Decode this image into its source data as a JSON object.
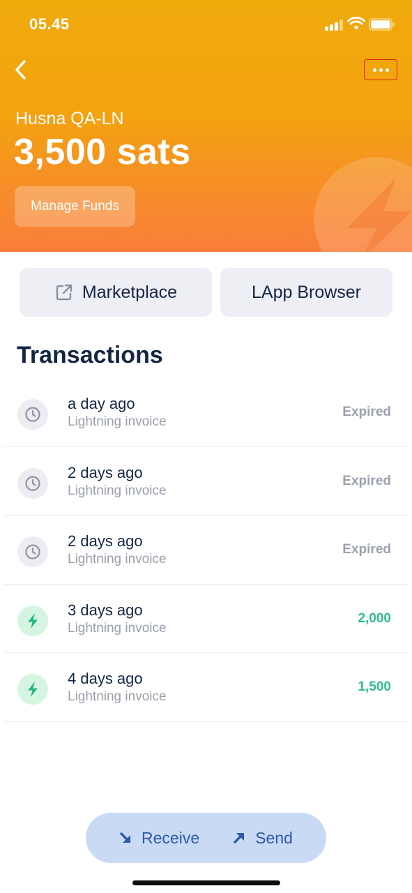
{
  "status_bar": {
    "time": "05.45"
  },
  "header": {
    "wallet_name": "Husna QA-LN",
    "balance": "3,500 sats",
    "manage_funds_label": "Manage Funds",
    "back_icon": "chevron-left-icon",
    "more_icon": "more-dots-icon",
    "gradient": {
      "top": "#f0aa0c",
      "bottom": "#f97e3a"
    }
  },
  "actions": {
    "marketplace_label": "Marketplace",
    "marketplace_icon": "external-link-icon",
    "lapp_browser_label": "LApp Browser"
  },
  "transactions": {
    "title": "Transactions",
    "items": [
      {
        "date": "a day ago",
        "type": "Lightning invoice",
        "amount": "Expired",
        "status": "expired",
        "icon": "clock-icon"
      },
      {
        "date": "2 days ago",
        "type": "Lightning invoice",
        "amount": "Expired",
        "status": "expired",
        "icon": "clock-icon"
      },
      {
        "date": "2 days ago",
        "type": "Lightning invoice",
        "amount": "Expired",
        "status": "expired",
        "icon": "clock-icon"
      },
      {
        "date": "3 days ago",
        "type": "Lightning invoice",
        "amount": "2,000",
        "status": "received",
        "icon": "lightning-icon"
      },
      {
        "date": "4 days ago",
        "type": "Lightning invoice",
        "amount": "1,500",
        "status": "received",
        "icon": "lightning-icon"
      }
    ]
  },
  "bottom_bar": {
    "receive_label": "Receive",
    "receive_icon": "arrow-down-right-icon",
    "send_label": "Send",
    "send_icon": "arrow-up-right-icon"
  },
  "colors": {
    "text_primary": "#132743",
    "text_muted": "#9aa0ad",
    "positive": "#2fbf8f",
    "bottom_bar_bg": "#c9daf5",
    "bottom_bar_text": "#2f5aa8"
  }
}
